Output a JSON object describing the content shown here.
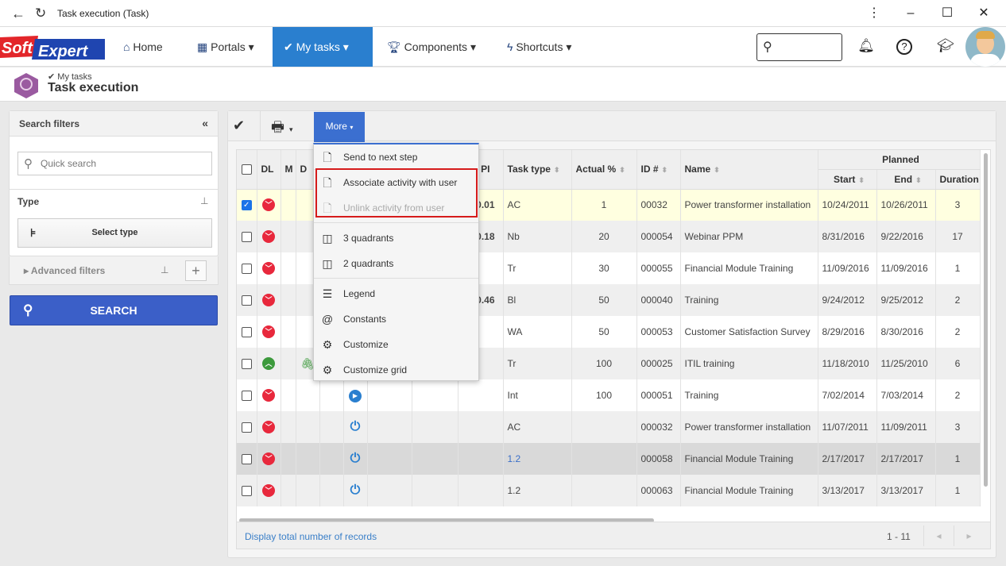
{
  "window": {
    "title": "Task execution (Task)"
  },
  "nav": {
    "logo": "SoftExpert",
    "items": [
      {
        "label": "Home",
        "icon": "home-icon"
      },
      {
        "label": "Portals",
        "icon": "portals-icon"
      },
      {
        "label": "My tasks",
        "icon": "check-icon",
        "active": true
      },
      {
        "label": "Components",
        "icon": "trophy-icon"
      },
      {
        "label": "Shortcuts",
        "icon": "bolt-icon"
      }
    ]
  },
  "header": {
    "breadcrumb": "My tasks",
    "title": "Task execution"
  },
  "filters": {
    "title": "Search filters",
    "quick_search_placeholder": "Quick search",
    "type_label": "Type",
    "select_type": "Select type",
    "advanced": "Advanced filters",
    "search": "SEARCH"
  },
  "toolbar": {
    "more": "More"
  },
  "menu": {
    "items": [
      "Send to next step",
      "Associate activity with user",
      "Unlink activity from user",
      "3 quadrants",
      "2 quadrants",
      "Legend",
      "Constants",
      "Customize",
      "Customize grid"
    ]
  },
  "grid": {
    "headers": {
      "dl": "DL",
      "m": "M",
      "d": "D",
      "pi": "PI",
      "task_type": "Task type",
      "actual": "Actual %",
      "id": "ID #",
      "name": "Name",
      "planned": "Planned",
      "start": "Start",
      "end": "End",
      "duration": "Duration"
    },
    "rows": [
      {
        "checked": true,
        "dl": "down",
        "clip": false,
        "status": "",
        "pi": "0.01",
        "type": "AC",
        "actual": "1",
        "id": "00032",
        "name": "Power transformer installation",
        "start": "10/24/2011",
        "end": "10/26/2011",
        "dur": "3"
      },
      {
        "checked": false,
        "dl": "down",
        "status": "",
        "pi": "0.18",
        "type": "Nb",
        "actual": "20",
        "id": "000054",
        "name": "Webinar PPM",
        "start": "8/31/2016",
        "end": "9/22/2016",
        "dur": "17"
      },
      {
        "checked": false,
        "dl": "down",
        "status": "",
        "pi": "",
        "type": "Tr",
        "actual": "30",
        "id": "000055",
        "name": "Financial Module Training",
        "start": "11/09/2016",
        "end": "11/09/2016",
        "dur": "1"
      },
      {
        "checked": false,
        "dl": "down",
        "status": "",
        "pi": "0.46",
        "type": "Bl",
        "actual": "50",
        "id": "000040",
        "name": "Training",
        "start": "9/24/2012",
        "end": "9/25/2012",
        "dur": "2"
      },
      {
        "checked": false,
        "dl": "down",
        "status": "",
        "pi": "",
        "type": "WA",
        "actual": "50",
        "id": "000053",
        "name": "Customer Satisfaction Survey",
        "start": "8/29/2016",
        "end": "8/30/2016",
        "dur": "2"
      },
      {
        "checked": false,
        "dl": "up",
        "clip": true,
        "status": "",
        "pi": "",
        "type": "Tr",
        "actual": "100",
        "id": "000025",
        "name": "ITIL training",
        "start": "11/18/2010",
        "end": "11/25/2010",
        "dur": "6"
      },
      {
        "checked": false,
        "dl": "down",
        "status": "play",
        "pi": "",
        "type": "Int",
        "actual": "100",
        "id": "000051",
        "name": "Training",
        "start": "7/02/2014",
        "end": "7/03/2014",
        "dur": "2"
      },
      {
        "checked": false,
        "dl": "down",
        "status": "power",
        "pi": "",
        "type": "AC",
        "actual": "",
        "id": "000032",
        "name": "Power transformer installation",
        "start": "11/07/2011",
        "end": "11/09/2011",
        "dur": "3"
      },
      {
        "checked": false,
        "dl": "down",
        "status": "power",
        "pi": "",
        "type": "1.2",
        "type_link": true,
        "actual": "",
        "id": "000058",
        "name": "Financial Module Training",
        "start": "2/17/2017",
        "end": "2/17/2017",
        "dur": "1"
      },
      {
        "checked": false,
        "dl": "down",
        "status": "power",
        "pi": "",
        "type": "1.2",
        "actual": "",
        "id": "000063",
        "name": "Financial Module Training",
        "start": "3/13/2017",
        "end": "3/13/2017",
        "dur": "1"
      }
    ],
    "footer_link": "Display total number of records",
    "range": "1 - 11"
  },
  "colors": {
    "accent": "#2a7fcf",
    "search": "#3b5fc8",
    "dl_down": "#e8283c",
    "dl_up": "#3c9a3c",
    "highlight": "#d61b1b",
    "selected_row": "#ffffe0"
  }
}
